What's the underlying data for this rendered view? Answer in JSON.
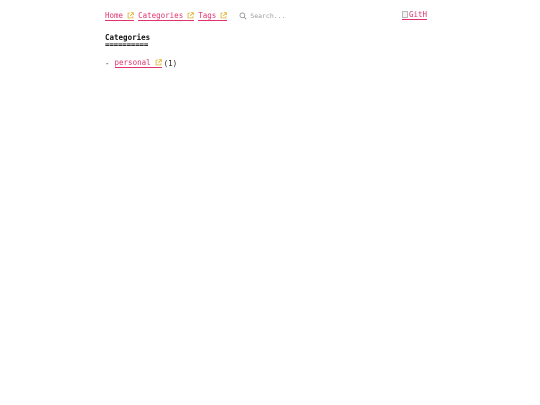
{
  "nav": {
    "items": [
      {
        "label": "Home"
      },
      {
        "label": "Categories"
      },
      {
        "label": "Tags"
      }
    ],
    "search_placeholder": "Search...",
    "github_label": "GitH"
  },
  "main": {
    "heading": "Categories",
    "heading_rule": "==========",
    "categories": [
      {
        "bullet": "-",
        "label": "personal",
        "count": "(1)"
      }
    ]
  },
  "colors": {
    "link": "#e0336e",
    "external_icon": "#d9a300"
  },
  "icons": {
    "external": "external-link-icon",
    "search": "search-icon",
    "github": "broken-image-icon"
  }
}
